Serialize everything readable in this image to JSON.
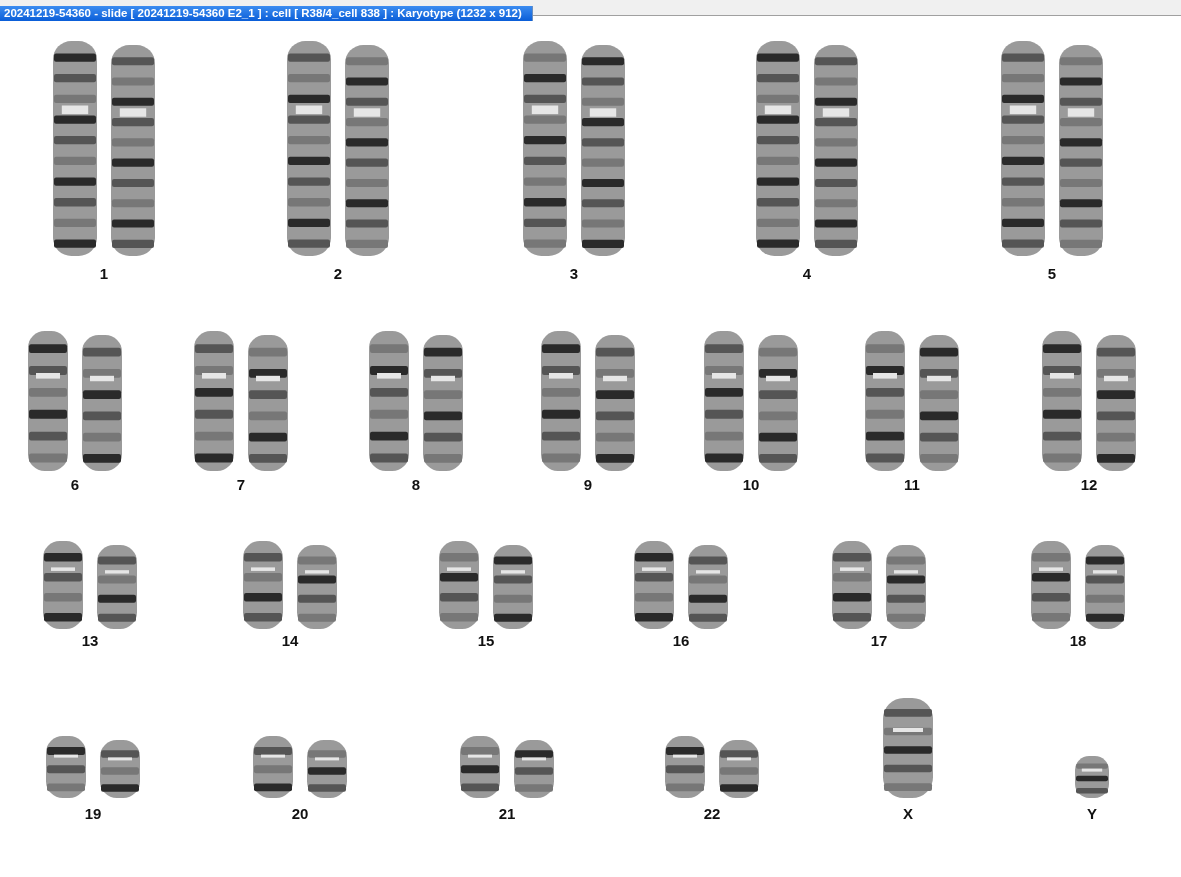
{
  "window": {
    "title": "20241219-54360 - slide [ 20241219-54360 E2_1 ] : cell [ R38/4_cell 838 ] : Karyotype  (1232 x 912)"
  },
  "karyotype": {
    "rows": [
      {
        "chromosomes": [
          {
            "label": "1",
            "kind": "pair"
          },
          {
            "label": "2",
            "kind": "pair"
          },
          {
            "label": "3",
            "kind": "pair"
          },
          {
            "label": "4",
            "kind": "pair"
          },
          {
            "label": "5",
            "kind": "pair"
          }
        ]
      },
      {
        "chromosomes": [
          {
            "label": "6",
            "kind": "pair"
          },
          {
            "label": "7",
            "kind": "pair"
          },
          {
            "label": "8",
            "kind": "pair"
          },
          {
            "label": "9",
            "kind": "pair"
          },
          {
            "label": "10",
            "kind": "pair"
          },
          {
            "label": "11",
            "kind": "pair"
          },
          {
            "label": "12",
            "kind": "pair"
          }
        ]
      },
      {
        "chromosomes": [
          {
            "label": "13",
            "kind": "pair"
          },
          {
            "label": "14",
            "kind": "pair"
          },
          {
            "label": "15",
            "kind": "pair"
          },
          {
            "label": "16",
            "kind": "pair"
          },
          {
            "label": "17",
            "kind": "pair"
          },
          {
            "label": "18",
            "kind": "pair"
          }
        ]
      },
      {
        "chromosomes": [
          {
            "label": "19",
            "kind": "pair"
          },
          {
            "label": "20",
            "kind": "pair"
          },
          {
            "label": "21",
            "kind": "pair"
          },
          {
            "label": "22",
            "kind": "pair"
          },
          {
            "label": "X",
            "kind": "single"
          },
          {
            "label": "Y",
            "kind": "single"
          }
        ]
      }
    ]
  }
}
